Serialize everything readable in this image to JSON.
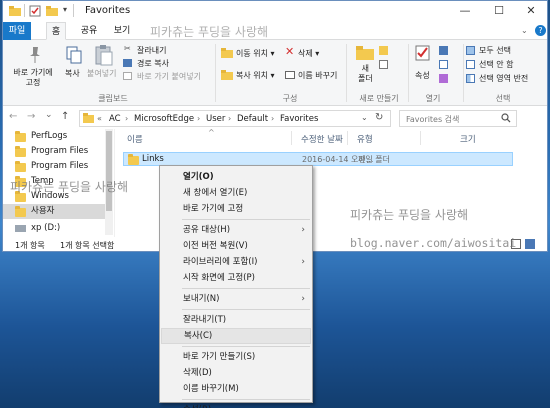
{
  "window": {
    "title": "Favorites",
    "controls": {
      "minimize": "—",
      "maximize": "☐",
      "close": "✕"
    }
  },
  "tabs": [
    "파일",
    "홈",
    "공유",
    "보기"
  ],
  "ribbon": {
    "pin": "바로 가기에\n고정",
    "copy": "복사",
    "paste": "붙여넣기",
    "cut": "잘라내기",
    "copy_path": "경로 복사",
    "paste_shortcut": "바로 가기 붙여넣기",
    "move_to": "이동 위치 ▾",
    "copy_to": "복사 위치 ▾",
    "delete": "삭제 ▾",
    "rename": "이름 바꾸기",
    "new_folder": "새\n폴더",
    "properties": "속성",
    "select_all": "모두 선택",
    "select_none": "선택 안 함",
    "invert_selection": "선택 영역 반전",
    "groups": {
      "clipboard": "클립보드",
      "organize": "구성",
      "new": "새로 만들기",
      "open": "열기",
      "select": "선택"
    }
  },
  "address": {
    "back": "←",
    "forward": "→",
    "recent": "⌄",
    "up": "↑",
    "overflow": "«",
    "crumbs": [
      "AC",
      "MicrosoftEdge",
      "User",
      "Default",
      "Favorites"
    ],
    "refresh": "↻",
    "search_placeholder": "Favorites 검색"
  },
  "nav": {
    "items": [
      "PerfLogs",
      "Program Files",
      "Program Files",
      "Temp",
      "Windows",
      "사용자",
      "xp (D:)"
    ]
  },
  "columns": {
    "name": "이름",
    "modified": "수정한 날짜",
    "type": "유형",
    "size": "크기"
  },
  "rows": [
    {
      "name": "Links",
      "modified": "2016-04-14 오전...",
      "type": "파일 폴더",
      "size": ""
    }
  ],
  "status": {
    "count": "1개 항목",
    "selected": "1개 항목 선택함"
  },
  "context_menu": [
    {
      "label": "열기(O)",
      "bold": true
    },
    {
      "label": "새 창에서 열기(E)"
    },
    {
      "label": "바로 가기에 고정"
    },
    {
      "sep": true
    },
    {
      "label": "공유 대상(H)",
      "submenu": true
    },
    {
      "label": "이전 버전 복원(V)"
    },
    {
      "label": "라이브러리에 포함(I)",
      "submenu": true
    },
    {
      "label": "시작 화면에 고정(P)"
    },
    {
      "sep": true
    },
    {
      "label": "보내기(N)",
      "submenu": true
    },
    {
      "sep": true
    },
    {
      "label": "잘라내기(T)"
    },
    {
      "label": "복사(C)",
      "highlighted": true
    },
    {
      "sep": true
    },
    {
      "label": "바로 가기 만들기(S)"
    },
    {
      "label": "삭제(D)"
    },
    {
      "label": "이름 바꾸기(M)"
    },
    {
      "sep": true
    },
    {
      "label": "속성(R)"
    }
  ],
  "watermarks": {
    "top": "피카츄는 푸딩을 사랑해",
    "left": "피카츄는 푸딩을 사랑해",
    "right": "피카츄는 푸딩을 사랑해",
    "blog": "blog.naver.com/aiwositai"
  },
  "colors": {
    "file_tab": "#1979ca",
    "selection": "#cce8ff",
    "folder": "#f3c94f"
  }
}
